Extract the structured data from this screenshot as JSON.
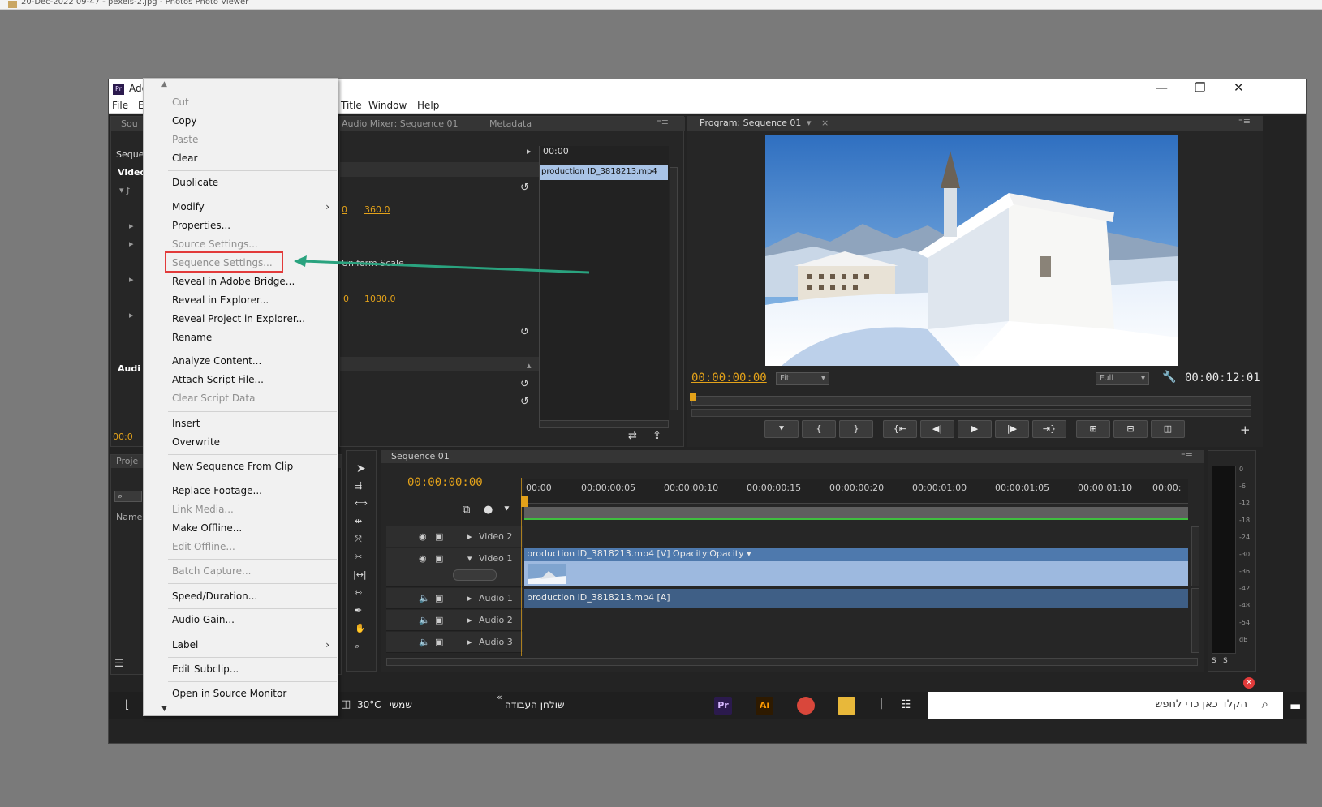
{
  "viewer": {
    "title": "20-Dec-2022 09-47 - pexels-2.jpg - Photos Photo Viewer"
  },
  "app": {
    "title": "Ado",
    "menus": [
      "File",
      "E",
      "Title",
      "Window",
      "Help"
    ],
    "win_min": "—",
    "win_max": "❐",
    "win_close": "✕"
  },
  "left_panel": {
    "tab": "Sou",
    "labels": [
      "Seque",
      "Video",
      "Audi",
      "00:0"
    ]
  },
  "effect_controls": {
    "tabs": [
      "Audio Mixer: Sequence 01",
      "Metadata"
    ],
    "ruler_tc": "00:00",
    "clip_label": "production ID_3818213.mp4",
    "values": {
      "pos1": "0",
      "pos2": "360.0",
      "uniform_scale": "Uniform Scale",
      "anchor1": "0",
      "anchor2": "1080.0"
    }
  },
  "program_monitor": {
    "tab": "Program: Sequence 01",
    "timecode_current": "00:00:00:00",
    "timecode_total": "00:00:12:01",
    "fit": "Fit",
    "quality": "Full"
  },
  "project_panel": {
    "tab": "Proje",
    "name_header": "Name"
  },
  "timeline": {
    "tab": "Sequence 01",
    "timecode": "00:00:00:00",
    "ruler": [
      "00:00",
      "00:00:00:05",
      "00:00:00:10",
      "00:00:00:15",
      "00:00:00:20",
      "00:00:01:00",
      "00:00:01:05",
      "00:00:01:10",
      "00:00:"
    ],
    "tracks": [
      "Video 2",
      "Video 1",
      "Audio 1",
      "Audio 2",
      "Audio 3"
    ],
    "video_clip": "production ID_3818213.mp4 [V]  Opacity:Opacity ▾",
    "audio_clip": "production ID_3818213.mp4 [A]"
  },
  "audio_meter": {
    "scale": [
      "0",
      "-6",
      "-12",
      "-18",
      "-24",
      "-30",
      "-36",
      "-42",
      "-48",
      "-54",
      "dB"
    ]
  },
  "context_menu": {
    "items": [
      {
        "label": "Cut",
        "disabled": true
      },
      {
        "label": "Copy",
        "disabled": false
      },
      {
        "label": "Paste",
        "disabled": true
      },
      {
        "label": "Clear",
        "disabled": false
      },
      {
        "label": "Duplicate",
        "disabled": false
      },
      {
        "label": "Modify",
        "disabled": false,
        "submenu": true
      },
      {
        "label": "Properties...",
        "disabled": false
      },
      {
        "label": "Source Settings...",
        "disabled": true
      },
      {
        "label": "Sequence Settings...",
        "disabled": true,
        "highlighted": true
      },
      {
        "label": "Reveal in Adobe Bridge...",
        "disabled": false
      },
      {
        "label": "Reveal in Explorer...",
        "disabled": false
      },
      {
        "label": "Reveal Project in Explorer...",
        "disabled": false
      },
      {
        "label": "Rename",
        "disabled": false
      },
      {
        "label": "Analyze Content...",
        "disabled": false
      },
      {
        "label": "Attach Script File...",
        "disabled": false
      },
      {
        "label": "Clear Script Data",
        "disabled": true
      },
      {
        "label": "Insert",
        "disabled": false
      },
      {
        "label": "Overwrite",
        "disabled": false
      },
      {
        "label": "New Sequence From Clip",
        "disabled": false
      },
      {
        "label": "Replace Footage...",
        "disabled": false
      },
      {
        "label": "Link Media...",
        "disabled": true
      },
      {
        "label": "Make Offline...",
        "disabled": false
      },
      {
        "label": "Edit Offline...",
        "disabled": true
      },
      {
        "label": "Batch Capture...",
        "disabled": true
      },
      {
        "label": "Speed/Duration...",
        "disabled": false
      },
      {
        "label": "Audio Gain...",
        "disabled": false
      },
      {
        "label": "Label",
        "disabled": false,
        "submenu": true
      },
      {
        "label": "Edit Subclip...",
        "disabled": false
      },
      {
        "label": "Open in Source Monitor",
        "disabled": false
      }
    ]
  },
  "taskbar": {
    "weather": "30°C",
    "weather_label": "שמשי",
    "news": "שולחן העבודה",
    "search_placeholder": "הקלד כאן כדי לחפש",
    "apps": [
      "Pr",
      "Ai"
    ]
  },
  "colors": {
    "accent_orange": "#e3a21a",
    "annotation_green": "#2aa37f",
    "highlight_red": "#e23b3b",
    "clip_blue": "#9db9df"
  }
}
